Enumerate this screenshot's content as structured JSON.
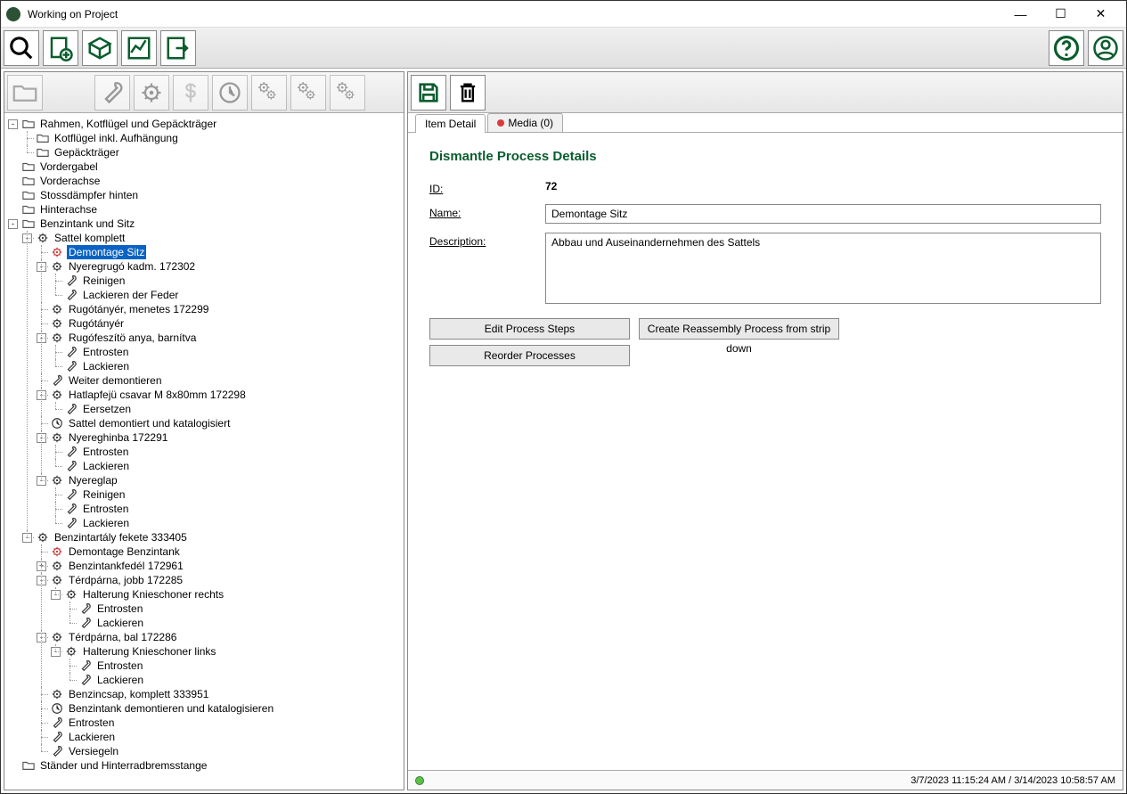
{
  "window": {
    "title": "Working on Project"
  },
  "tabs": {
    "item_detail": "Item Detail",
    "media": "Media (0)"
  },
  "detail": {
    "heading": "Dismantle Process Details",
    "id_label": "ID:",
    "id_value": "72",
    "name_label": "Name:",
    "name_value": "Demontage Sitz",
    "desc_label": "Description:",
    "desc_value": "Abbau und Auseinandernehmen des Sattels",
    "btn_edit": "Edit Process Steps",
    "btn_create": "Create Reassembly Process from strip down",
    "btn_reorder": "Reorder Processes"
  },
  "status": {
    "text": "3/7/2023 11:15:24 AM / 3/14/2023 10:58:57 AM"
  },
  "tree": [
    {
      "exp": "-",
      "icon": "folder",
      "label": "Rahmen, Kotflügel und Gepäckträger",
      "children": [
        {
          "exp": "",
          "icon": "folder",
          "label": "Kotflügel inkl. Aufhängung"
        },
        {
          "exp": "",
          "icon": "folder",
          "label": "Gepäckträger"
        }
      ]
    },
    {
      "exp": "",
      "icon": "folder",
      "label": "Vordergabel"
    },
    {
      "exp": "",
      "icon": "folder",
      "label": "Vorderachse"
    },
    {
      "exp": "",
      "icon": "folder",
      "label": "Stossdämpfer hinten"
    },
    {
      "exp": "",
      "icon": "folder",
      "label": "Hinterachse"
    },
    {
      "exp": "-",
      "icon": "folder",
      "label": "Benzintank und Sitz",
      "children": [
        {
          "exp": "-",
          "icon": "gear",
          "label": "Sattel komplett",
          "children": [
            {
              "exp": "",
              "icon": "gear-red",
              "label": "Demontage Sitz",
              "selected": true
            },
            {
              "exp": "-",
              "icon": "gear",
              "label": "Nyeregrugó kadm. 172302",
              "children": [
                {
                  "exp": "",
                  "icon": "wrench",
                  "label": "Reinigen"
                },
                {
                  "exp": "",
                  "icon": "wrench",
                  "label": "Lackieren der Feder"
                }
              ]
            },
            {
              "exp": "",
              "icon": "gear",
              "label": "Rugótányér, menetes 172299"
            },
            {
              "exp": "",
              "icon": "gear",
              "label": "Rugótányér"
            },
            {
              "exp": "-",
              "icon": "gear",
              "label": "Rugófeszítö anya, barnítva",
              "children": [
                {
                  "exp": "",
                  "icon": "wrench",
                  "label": "Entrosten"
                },
                {
                  "exp": "",
                  "icon": "wrench",
                  "label": "Lackieren"
                }
              ]
            },
            {
              "exp": "",
              "icon": "wrench",
              "label": "Weiter demontieren"
            },
            {
              "exp": "-",
              "icon": "gear",
              "label": "Hatlapfejü csavar M 8x80mm 172298",
              "children": [
                {
                  "exp": "",
                  "icon": "wrench",
                  "label": "Eersetzen"
                }
              ]
            },
            {
              "exp": "",
              "icon": "clock",
              "label": "Sattel demontiert und katalogisiert"
            },
            {
              "exp": "-",
              "icon": "gear",
              "label": "Nyereghinba 172291",
              "children": [
                {
                  "exp": "",
                  "icon": "wrench",
                  "label": "Entrosten"
                },
                {
                  "exp": "",
                  "icon": "wrench",
                  "label": "Lackieren"
                }
              ]
            },
            {
              "exp": "-",
              "icon": "gear",
              "label": "Nyereglap",
              "children": [
                {
                  "exp": "",
                  "icon": "wrench",
                  "label": "Reinigen"
                },
                {
                  "exp": "",
                  "icon": "wrench",
                  "label": "Entrosten"
                },
                {
                  "exp": "",
                  "icon": "wrench",
                  "label": "Lackieren"
                }
              ]
            }
          ]
        },
        {
          "exp": "-",
          "icon": "gear",
          "label": "Benzintartály fekete 333405",
          "children": [
            {
              "exp": "",
              "icon": "gear-red",
              "label": "Demontage Benzintank"
            },
            {
              "exp": "+",
              "icon": "gear",
              "label": "Benzintankfedél 172961"
            },
            {
              "exp": "-",
              "icon": "gear",
              "label": "Térdpárna, jobb 172285",
              "children": [
                {
                  "exp": "-",
                  "icon": "gear",
                  "label": "Halterung Knieschoner rechts",
                  "children": [
                    {
                      "exp": "",
                      "icon": "wrench",
                      "label": "Entrosten"
                    },
                    {
                      "exp": "",
                      "icon": "wrench",
                      "label": "Lackieren"
                    }
                  ]
                }
              ]
            },
            {
              "exp": "-",
              "icon": "gear",
              "label": "Térdpárna, bal 172286",
              "children": [
                {
                  "exp": "-",
                  "icon": "gear",
                  "label": "Halterung Knieschoner links",
                  "children": [
                    {
                      "exp": "",
                      "icon": "wrench",
                      "label": "Entrosten"
                    },
                    {
                      "exp": "",
                      "icon": "wrench",
                      "label": "Lackieren"
                    }
                  ]
                }
              ]
            },
            {
              "exp": "",
              "icon": "gear",
              "label": "Benzincsap, komplett 333951"
            },
            {
              "exp": "",
              "icon": "clock",
              "label": "Benzintank demontieren und katalogisieren"
            },
            {
              "exp": "",
              "icon": "wrench",
              "label": "Entrosten"
            },
            {
              "exp": "",
              "icon": "wrench",
              "label": "Lackieren"
            },
            {
              "exp": "",
              "icon": "wrench",
              "label": "Versiegeln"
            }
          ]
        }
      ]
    },
    {
      "exp": "",
      "icon": "folder",
      "label": "Ständer und Hinterradbremsstange"
    }
  ]
}
